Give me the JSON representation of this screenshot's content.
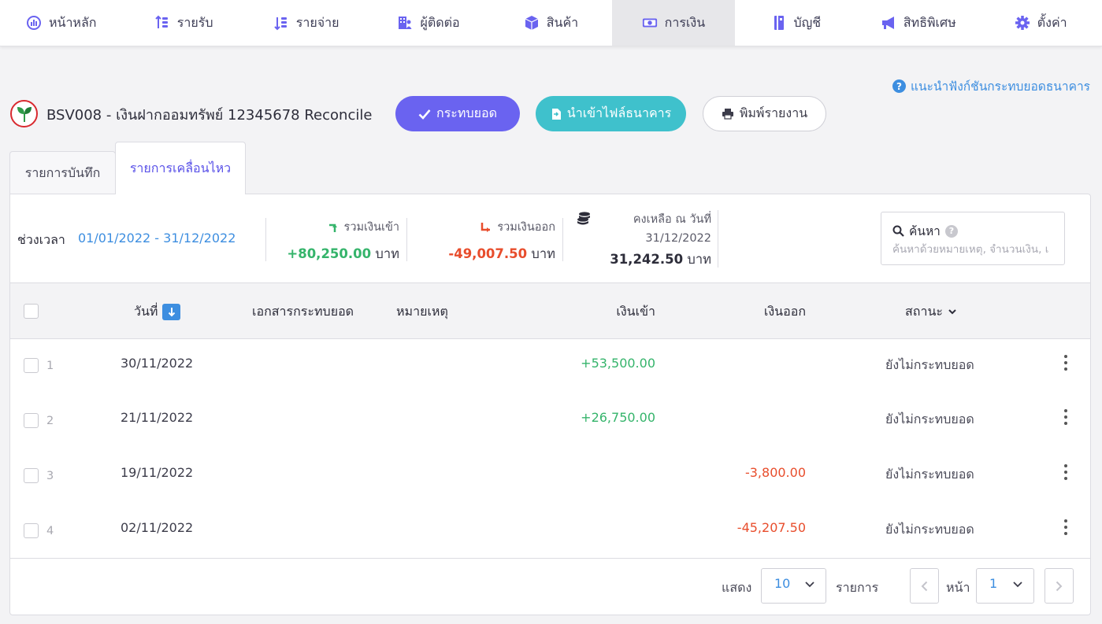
{
  "nav": {
    "items": [
      {
        "label": "หน้าหลัก",
        "icon": "dashboard-icon"
      },
      {
        "label": "รายรับ",
        "icon": "income-icon"
      },
      {
        "label": "รายจ่าย",
        "icon": "expense-icon"
      },
      {
        "label": "ผู้ติดต่อ",
        "icon": "contacts-icon"
      },
      {
        "label": "สินค้า",
        "icon": "product-box-icon"
      },
      {
        "label": "การเงิน",
        "icon": "money-icon"
      },
      {
        "label": "บัญชี",
        "icon": "ledger-icon"
      },
      {
        "label": "สิทธิพิเศษ",
        "icon": "megaphone-icon"
      },
      {
        "label": "ตั้งค่า",
        "icon": "gear-icon"
      }
    ],
    "active_index": 5
  },
  "help_link": "แนะนำฟังก์ชันกระทบยอดธนาคาร",
  "header": {
    "title": "BSV008 - เงินฝากออมทรัพย์ 12345678 Reconcile",
    "reconcile_button": "กระทบยอด",
    "import_button": "นำเข้าไฟล์ธนาคาร",
    "print_button": "พิมพ์รายงาน"
  },
  "tabs": [
    {
      "label": "รายการบันทึก",
      "active": false
    },
    {
      "label": "รายการเคลื่อนไหว",
      "active": true
    }
  ],
  "summary": {
    "period_label": "ช่วงเวลา",
    "period_value": "01/01/2022 - 31/12/2022",
    "total_in_label": "รวมเงินเข้า",
    "total_in_value": "+80,250.00",
    "total_out_label": "รวมเงินออก",
    "total_out_value": "-49,007.50",
    "balance_label": "คงเหลือ ณ วันที่",
    "balance_date": "31/12/2022",
    "balance_value": "31,242.50",
    "unit": "บาท"
  },
  "search": {
    "label": "ค้นหา",
    "placeholder": "ค้นหาด้วยหมายเหตุ, จำนวนเงิน, เ"
  },
  "table": {
    "columns": {
      "date": "วันที่",
      "document": "เอกสารกระทบยอด",
      "note": "หมายเหตุ",
      "money_in": "เงินเข้า",
      "money_out": "เงินออก",
      "status": "สถานะ"
    },
    "rows": [
      {
        "num": "1",
        "date": "30/11/2022",
        "money_in": "+53,500.00",
        "money_out": "",
        "status": "ยังไม่กระทบยอด"
      },
      {
        "num": "2",
        "date": "21/11/2022",
        "money_in": "+26,750.00",
        "money_out": "",
        "status": "ยังไม่กระทบยอด"
      },
      {
        "num": "3",
        "date": "19/11/2022",
        "money_in": "",
        "money_out": "-3,800.00",
        "status": "ยังไม่กระทบยอด"
      },
      {
        "num": "4",
        "date": "02/11/2022",
        "money_in": "",
        "money_out": "-45,207.50",
        "status": "ยังไม่กระทบยอด"
      }
    ]
  },
  "pagination": {
    "show_label": "แสดง",
    "per_page": "10",
    "items_label": "รายการ",
    "page_label": "หน้า",
    "page": "1"
  },
  "colors": {
    "accent_purple": "#6a63f0",
    "accent_teal": "#3fc1cc",
    "link_blue": "#3d8ee0",
    "positive_green": "#35b46b",
    "negative_red": "#e84d2c"
  }
}
